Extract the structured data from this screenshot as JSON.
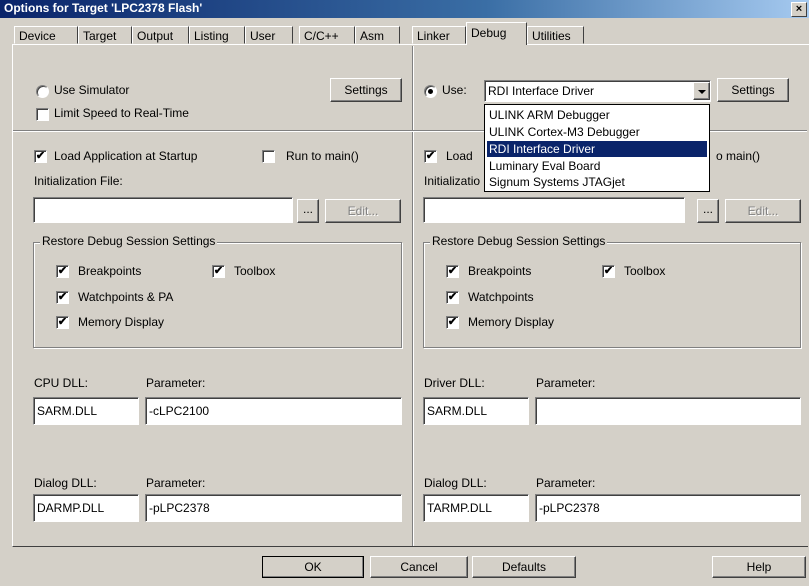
{
  "window": {
    "title": "Options for Target 'LPC2378 Flash'",
    "close_glyph": "×"
  },
  "tabs": [
    {
      "label": "Device"
    },
    {
      "label": "Target"
    },
    {
      "label": "Output"
    },
    {
      "label": "Listing"
    },
    {
      "label": "User"
    },
    {
      "label": "C/C++"
    },
    {
      "label": "Asm"
    },
    {
      "label": "Linker"
    },
    {
      "label": "Debug",
      "active": true
    },
    {
      "label": "Utilities"
    }
  ],
  "left": {
    "use_simulator": "Use Simulator",
    "limit_speed": "Limit Speed to Real-Time",
    "settings_btn": "Settings",
    "load_app": "Load Application at Startup",
    "run_to_main": "Run to main()",
    "init_file_label": "Initialization File:",
    "init_file_value": "",
    "browse": "...",
    "edit": "Edit...",
    "restore_title": "Restore Debug Session Settings",
    "breakpoints": "Breakpoints",
    "toolbox": "Toolbox",
    "watchpoints": "Watchpoints & PA",
    "memory_display": "Memory Display",
    "cpu_dll_label": "CPU DLL:",
    "cpu_param_label": "Parameter:",
    "cpu_dll": "SARM.DLL",
    "cpu_param": "-cLPC2100",
    "dialog_dll_label": "Dialog DLL:",
    "dialog_param_label": "Parameter:",
    "dialog_dll": "DARMP.DLL",
    "dialog_param": "-pLPC2378"
  },
  "right": {
    "use_label": "Use:",
    "use_value": "RDI Interface Driver",
    "settings_btn": "Settings",
    "load_app": "Load",
    "run_to_main_tail": "o main()",
    "init_file_label": "Initializatio",
    "init_file_value": "",
    "browse": "...",
    "edit": "Edit...",
    "restore_title": "Restore Debug Session Settings",
    "breakpoints": "Breakpoints",
    "toolbox": "Toolbox",
    "watchpoints": "Watchpoints",
    "memory_display": "Memory Display",
    "driver_dll_label": "Driver DLL:",
    "driver_param_label": "Parameter:",
    "driver_dll": "SARM.DLL",
    "driver_param": "",
    "dialog_dll_label": "Dialog DLL:",
    "dialog_param_label": "Parameter:",
    "dialog_dll": "TARMP.DLL",
    "dialog_param": "-pLPC2378"
  },
  "dropdown_options": [
    "ULINK ARM Debugger",
    "ULINK Cortex-M3 Debugger",
    "RDI Interface Driver",
    "Luminary Eval Board",
    "Signum Systems JTAGjet"
  ],
  "footer": {
    "ok": "OK",
    "cancel": "Cancel",
    "defaults": "Defaults",
    "help": "Help"
  },
  "check_glyph": "✔"
}
